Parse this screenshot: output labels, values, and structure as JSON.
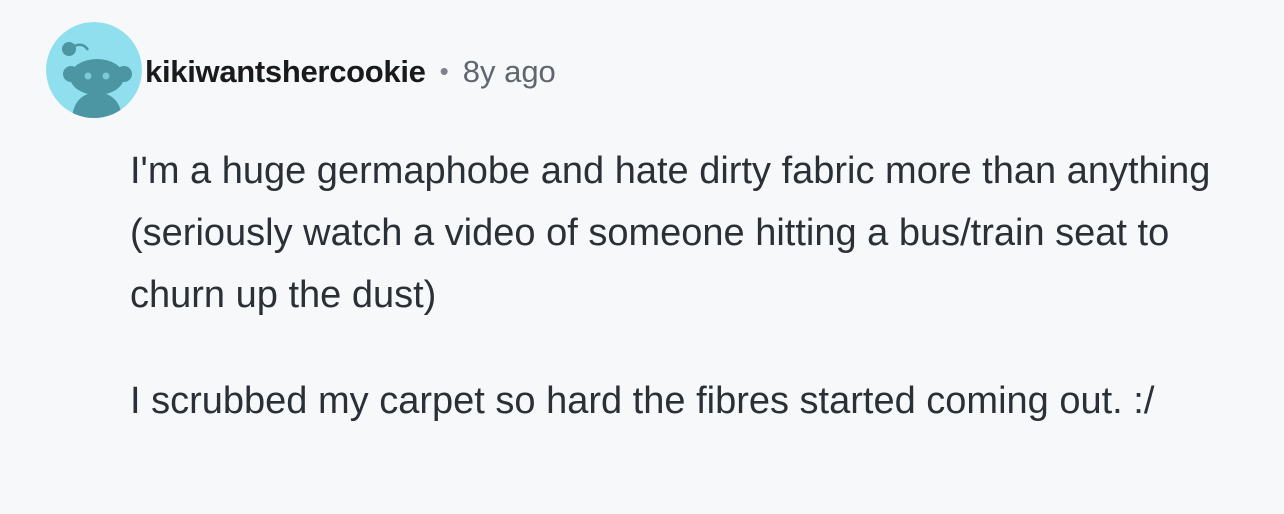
{
  "comment": {
    "avatar_icon": "reddit-snoo-avatar-icon",
    "username": "kikiwantshercookie",
    "separator": "•",
    "timestamp": "8y ago",
    "paragraphs": [
      "I'm a huge germaphobe and hate dirty fabric more than anything (seriously watch a video of someone hitting a bus/train seat to churn up the dust)",
      "I scrubbed my carpet so hard the fibres started coming out. :/"
    ]
  },
  "colors": {
    "background": "#f7f8fa",
    "avatar_bg": "#8fdfee",
    "avatar_figure": "#4c95a3",
    "username": "#1a1a1b",
    "timestamp": "#5f666e",
    "body_text": "#2a3036"
  }
}
